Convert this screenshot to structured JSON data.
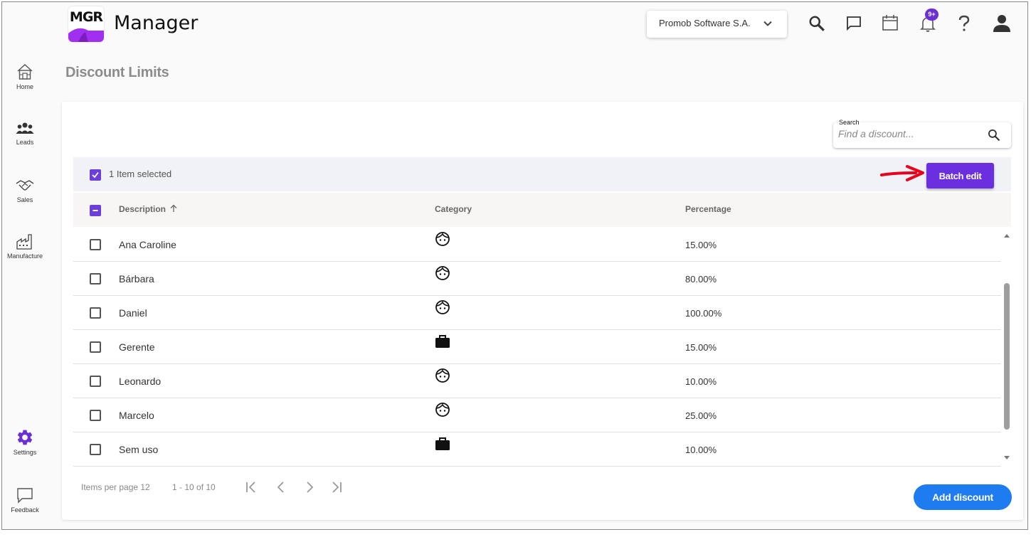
{
  "app": {
    "logo_text": "MGR",
    "title": "Manager"
  },
  "header": {
    "company": "Promob Software S.A.",
    "notification_badge": "9+",
    "icons": [
      "search-icon",
      "chat-icon",
      "calendar-icon",
      "bell-icon",
      "help-icon",
      "account-icon"
    ]
  },
  "sidebar": {
    "items": [
      {
        "label": "Home",
        "icon": "home-icon"
      },
      {
        "label": "Leads",
        "icon": "people-icon"
      },
      {
        "label": "Sales",
        "icon": "handshake-icon"
      },
      {
        "label": "Manufacture",
        "icon": "factory-icon"
      },
      {
        "label": "Settings",
        "icon": "gear-icon",
        "active": true
      },
      {
        "label": "Feedback",
        "icon": "feedback-icon"
      }
    ]
  },
  "page": {
    "title": "Discount Limits"
  },
  "search": {
    "label": "Search",
    "placeholder": "Find a discount..."
  },
  "selection": {
    "text": "1 Item selected",
    "batch_label": "Batch edit"
  },
  "table": {
    "headers": {
      "description": "Description",
      "category": "Category",
      "percentage": "Percentage"
    },
    "sort": "ascending",
    "rows": [
      {
        "description": "Ana Caroline",
        "category_icon": "face-icon",
        "percentage": "15.00%"
      },
      {
        "description": "Bárbara",
        "category_icon": "face-icon",
        "percentage": "80.00%"
      },
      {
        "description": "Daniel",
        "category_icon": "face-icon",
        "percentage": "100.00%"
      },
      {
        "description": "Gerente",
        "category_icon": "briefcase-icon",
        "percentage": "15.00%"
      },
      {
        "description": "Leonardo",
        "category_icon": "face-icon",
        "percentage": "10.00%"
      },
      {
        "description": "Marcelo",
        "category_icon": "face-icon",
        "percentage": "25.00%"
      },
      {
        "description": "Sem uso",
        "category_icon": "briefcase-icon",
        "percentage": "10.00%"
      }
    ]
  },
  "pagination": {
    "items_per_page": "Items per page 12",
    "range": "1 - 10 of 10"
  },
  "actions": {
    "add_label": "Add discount"
  },
  "colors": {
    "accent": "#6b2fe0",
    "primary": "#1e7cf0",
    "annotation": "#e8001c"
  }
}
